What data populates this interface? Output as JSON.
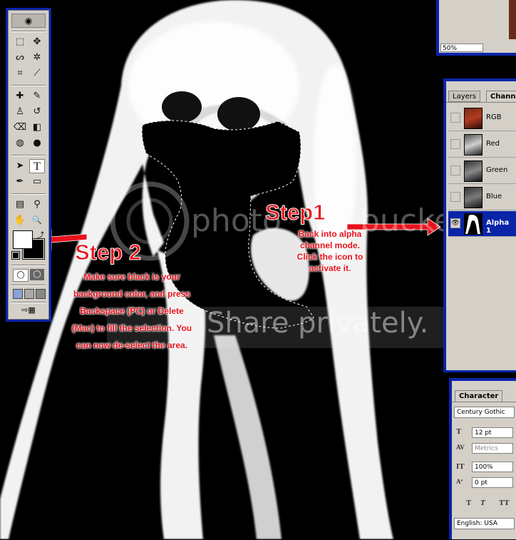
{
  "toolbox": {
    "tools": [
      {
        "id": "marquee",
        "glyph": "⬚"
      },
      {
        "id": "move",
        "glyph": "✥"
      },
      {
        "id": "lasso",
        "glyph": "ᔕ"
      },
      {
        "id": "magic-wand",
        "glyph": "✲"
      },
      {
        "id": "crop",
        "glyph": "⌗"
      },
      {
        "id": "slice",
        "glyph": "⟋"
      },
      {
        "id": "healing",
        "glyph": "✚"
      },
      {
        "id": "brush",
        "glyph": "✎"
      },
      {
        "id": "stamp",
        "glyph": "♙"
      },
      {
        "id": "history-brush",
        "glyph": "↺"
      },
      {
        "id": "eraser",
        "glyph": "⌫"
      },
      {
        "id": "gradient",
        "glyph": "◧"
      },
      {
        "id": "blur",
        "glyph": "◍"
      },
      {
        "id": "dodge",
        "glyph": "●"
      },
      {
        "id": "path-select",
        "glyph": "➤"
      },
      {
        "id": "type",
        "glyph": "T"
      },
      {
        "id": "pen",
        "glyph": "✒"
      },
      {
        "id": "shape",
        "glyph": "▭"
      },
      {
        "id": "notes",
        "glyph": "▤"
      },
      {
        "id": "eyedropper",
        "glyph": "⚲"
      },
      {
        "id": "hand",
        "glyph": "✋"
      },
      {
        "id": "zoom",
        "glyph": "🔍"
      }
    ]
  },
  "step1": {
    "title": "Step1",
    "lines": [
      "Back into alpha",
      "channel mode.",
      "Click the icon to",
      "activate it."
    ]
  },
  "step2": {
    "title": "Step 2",
    "lines": [
      "Make sure black is your",
      "background color, and press",
      "Backspace (PC) or Delete",
      "(Mac) to fill the selection.  You",
      "can now de-select the area."
    ]
  },
  "watermark": {
    "left": "photo",
    "right": "bucket",
    "tagline": "Share privately."
  },
  "navigator": {
    "zoom": "50%"
  },
  "channels": {
    "tabs": [
      "Layers",
      "Channels"
    ],
    "active_tab": "Channels",
    "rows": [
      {
        "label": "RGB",
        "visible": false,
        "selected": false
      },
      {
        "label": "Red",
        "visible": false,
        "selected": false
      },
      {
        "label": "Green",
        "visible": false,
        "selected": false
      },
      {
        "label": "Blue",
        "visible": false,
        "selected": false
      },
      {
        "label": "Alpha 1",
        "visible": true,
        "selected": true
      }
    ]
  },
  "character": {
    "tab": "Character",
    "font_family": "Century Gothic",
    "font_size": "12 pt",
    "kerning": "Metrics",
    "vertical_scale": "100%",
    "baseline_shift": "0 pt",
    "style_glyphs": [
      "T",
      "T",
      "TT"
    ],
    "language": "English: USA"
  },
  "colors": {
    "accent_red": "#e8121b",
    "palette_gray": "#d4d0c8",
    "palette_blue": "#0a24a8"
  }
}
